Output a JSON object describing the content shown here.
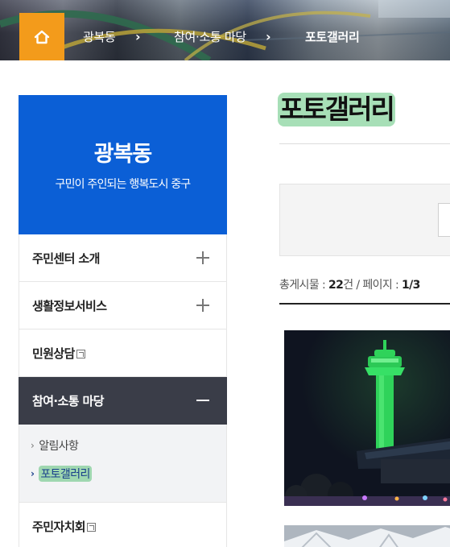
{
  "breadcrumb": {
    "home_icon": "home-icon",
    "items": [
      "광복동",
      "참여·소통 마당",
      "포토갤러리"
    ],
    "separator": "›"
  },
  "sidebar": {
    "title": "광복동",
    "slogan": "구민이 주인되는 행복도시 중구",
    "items": [
      {
        "label": "주민센터 소개",
        "toggle": "plus-icon"
      },
      {
        "label": "생활정보서비스",
        "toggle": "plus-icon"
      },
      {
        "label": "민원상담",
        "toggle": "new-window-icon"
      },
      {
        "label": "참여·소통 마당",
        "toggle": "minus-icon",
        "expanded": true
      },
      {
        "label": "주민자치회",
        "toggle": "new-window-icon"
      }
    ],
    "submenu": [
      {
        "label": "알림사항"
      },
      {
        "label": "포토갤러리",
        "current": true
      }
    ]
  },
  "main": {
    "title": "포토갤러리",
    "count": {
      "total_label": "총게시물 : ",
      "total_value": "22",
      "total_unit": "건",
      "page_label": " / 페이지 : ",
      "page_value": "1/3"
    }
  },
  "colors": {
    "home_button": "#f39b1b",
    "sidebar_header": "#0b5fd6",
    "active_menu": "#3a3d48",
    "highlight": "#a7dfb7"
  }
}
